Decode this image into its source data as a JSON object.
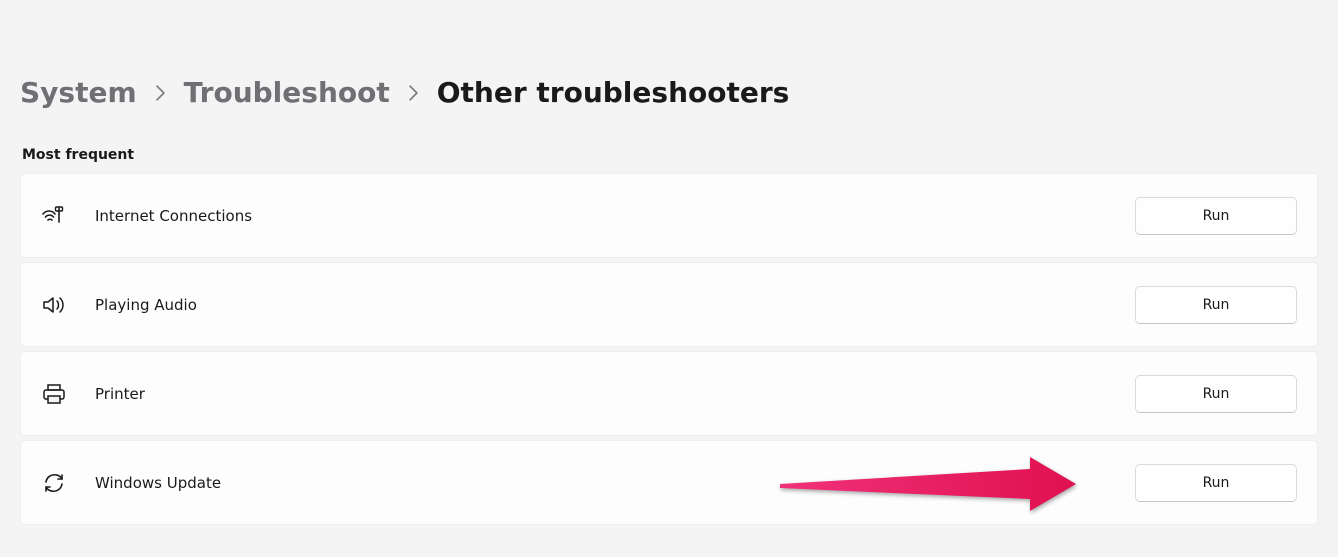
{
  "breadcrumb": {
    "crumb1": "System",
    "crumb2": "Troubleshoot",
    "current": "Other troubleshooters"
  },
  "section_title": "Most frequent",
  "items": [
    {
      "label": "Internet Connections",
      "button": "Run"
    },
    {
      "label": "Playing Audio",
      "button": "Run"
    },
    {
      "label": "Printer",
      "button": "Run"
    },
    {
      "label": "Windows Update",
      "button": "Run"
    }
  ],
  "annotation": {
    "color": "#e91e63",
    "points_to": "windows-update-run-button"
  }
}
